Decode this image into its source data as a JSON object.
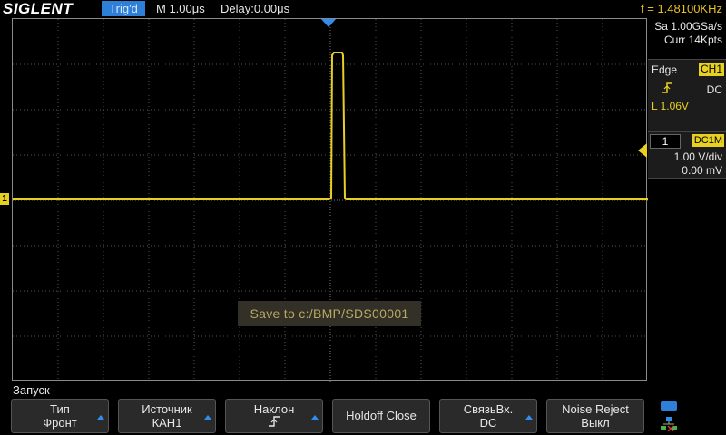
{
  "header": {
    "logo": "SIGLENT",
    "trig_status": "Trig'd",
    "timebase": "M 1.00μs",
    "delay": "Delay:0.00μs",
    "frequency": "f = 1.48100KHz"
  },
  "acquisition": {
    "sample_rate": "Sa 1.00GSa/s",
    "memory_depth": "Curr 14Kpts"
  },
  "trigger": {
    "type": "Edge",
    "source": "CH1",
    "slope_icon": "rising-edge-icon",
    "coupling": "DC",
    "level": "L  1.06V"
  },
  "channel": {
    "number": "1",
    "coupling": "DC1M",
    "volts_per_div": "1.00 V/div",
    "offset": "0.00 mV",
    "marker": "1"
  },
  "message": "Save  to  c:/BMP/SDS00001",
  "menu": {
    "title": "Запуск",
    "softkeys": [
      {
        "line1": "Тип",
        "line2": "Фронт",
        "has_arrow": true
      },
      {
        "line1": "Источник",
        "line2": "КАН1",
        "has_arrow": true
      },
      {
        "line1": "Наклон",
        "line2": "rising-edge-icon",
        "has_arrow": true
      },
      {
        "line1": "Holdoff Close",
        "line2": "",
        "has_arrow": false
      },
      {
        "line1": "СвязьВх.",
        "line2": "DC",
        "has_arrow": true
      },
      {
        "line1": "Noise Reject",
        "line2": "Выкл",
        "has_arrow": false
      }
    ]
  },
  "colors": {
    "trace": "#e8d020",
    "accent_blue": "#2e8ff0",
    "frequency_text": "#e8c020"
  }
}
